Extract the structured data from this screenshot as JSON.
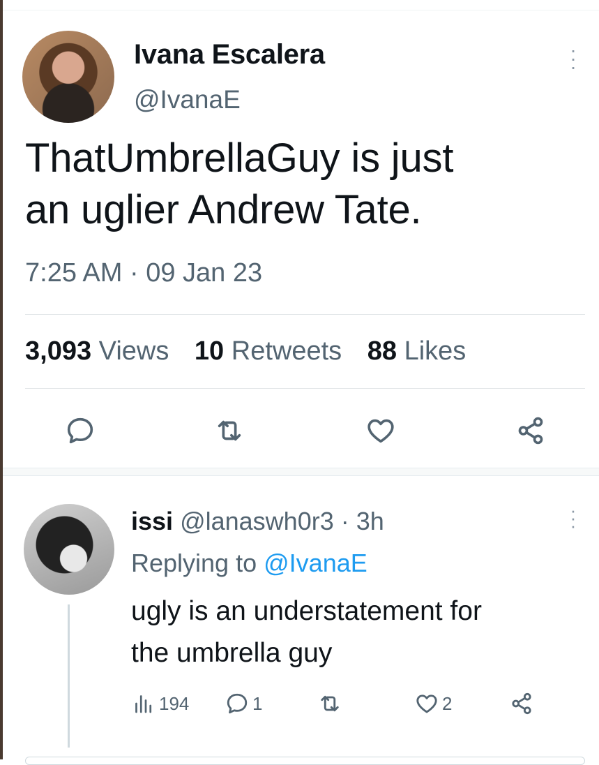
{
  "tweet": {
    "author_name": "Ivana Escalera",
    "author_handle": "@IvanaE",
    "text_line1": "ThatUmbrellaGuy is just",
    "text_line2": "an uglier Andrew Tate.",
    "meta": "7:25 AM · 09 Jan 23",
    "stats": {
      "views_count": "3,093",
      "views_label": "Views",
      "retweets_count": "10",
      "retweets_label": "Retweets",
      "likes_count": "88",
      "likes_label": "Likes"
    }
  },
  "reply": {
    "author_name": "issi",
    "author_handle": "@lanaswh0r3",
    "time": "· 3h",
    "replying_prefix": "Replying to",
    "replying_handle": "@IvanaE",
    "text_line1": "ugly is an understatement for",
    "text_line2": "the umbrella guy",
    "counts": {
      "views": "194",
      "replies": "1",
      "retweets": "",
      "likes": "2"
    }
  },
  "icons": {
    "more": "more-vertical-icon",
    "reply": "speech-bubble-icon",
    "retweet": "retweet-arrows-icon",
    "like": "heart-icon",
    "share": "share-nodes-icon",
    "views": "bar-chart-icon"
  },
  "colors": {
    "text": "#0f1419",
    "secondary": "#536471",
    "accent": "#1d9bf0",
    "border": "#e2e6e8"
  }
}
